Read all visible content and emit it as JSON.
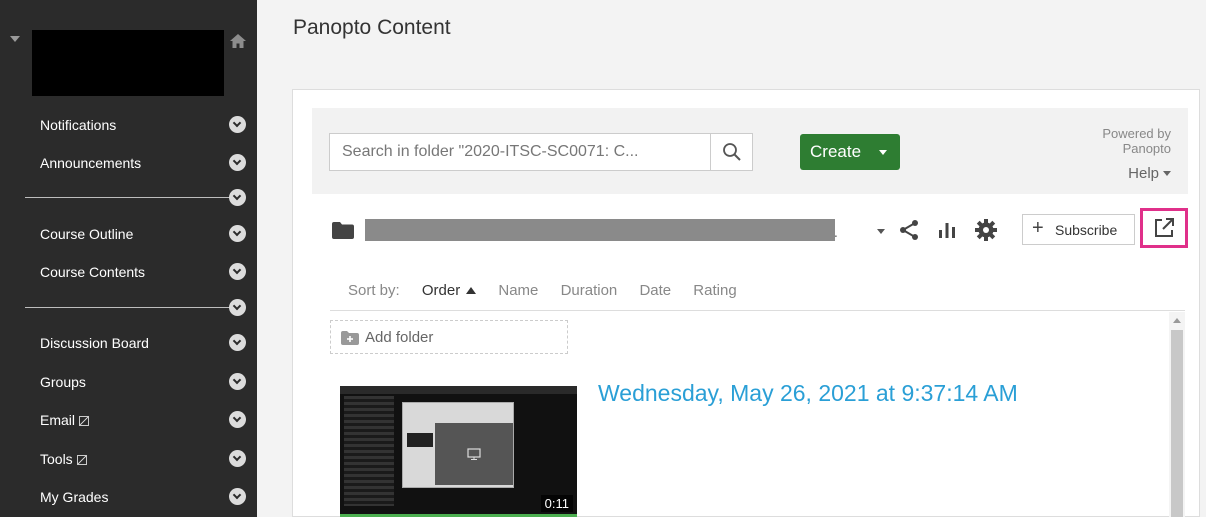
{
  "sidebar": {
    "items": [
      {
        "label": "Notifications",
        "external": false
      },
      {
        "label": "Announcements",
        "external": false
      },
      {
        "label": "Course Outline",
        "external": false
      },
      {
        "label": "Course Contents",
        "external": false
      },
      {
        "label": "Discussion Board",
        "external": false
      },
      {
        "label": "Groups",
        "external": false
      },
      {
        "label": "Email",
        "external": true
      },
      {
        "label": "Tools",
        "external": true
      },
      {
        "label": "My Grades",
        "external": false
      }
    ]
  },
  "main": {
    "title": "Panopto Content"
  },
  "panopto": {
    "search_placeholder": "Search in folder \"2020-ITSC-SC0071: C...",
    "create_label": "Create",
    "powered_by_line1": "Powered by",
    "powered_by_line2": "Panopto",
    "help_label": "Help",
    "subscribe_label": "Subscribe",
    "folder_suffix": ".",
    "sort": {
      "label": "Sort by:",
      "options": [
        "Order",
        "Name",
        "Duration",
        "Date",
        "Rating"
      ],
      "active": "Order"
    },
    "add_folder_label": "Add folder",
    "sessions": [
      {
        "title": "Wednesday, May 26, 2021 at 9:37:14 AM",
        "duration": "0:11"
      }
    ]
  },
  "colors": {
    "sidebar_bg": "#2b2b2b",
    "create_green": "#2e7d32",
    "link_blue": "#2a9fd6",
    "highlight_pink": "#e0308a"
  }
}
